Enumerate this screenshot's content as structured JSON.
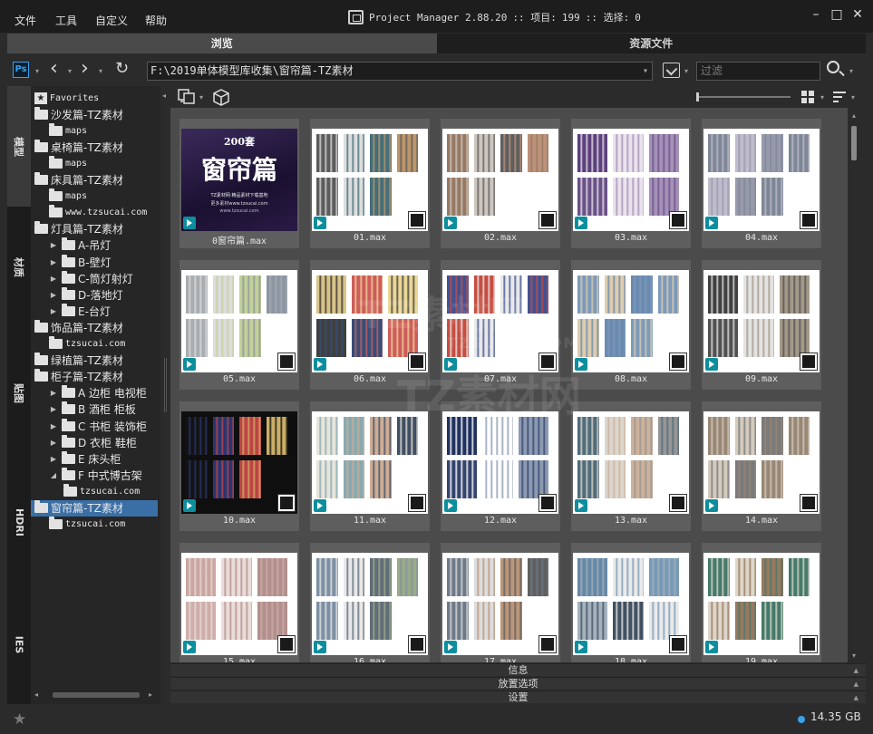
{
  "menu": [
    "文件",
    "工具",
    "自定义",
    "帮助"
  ],
  "title": {
    "app": "Project Manager 2.88.20",
    "items_label": ":: 项目:",
    "items_count": "199",
    "sel_label": ":: 选择:",
    "sel_count": "0"
  },
  "tabs": [
    {
      "label": "浏览",
      "active": true
    },
    {
      "label": "资源文件",
      "active": false
    }
  ],
  "path": {
    "value": "F:\\2019单体模型库收集\\窗帘篇-TZ素材",
    "filter_placeholder": "过滤"
  },
  "side_tabs": [
    "模型",
    "材质",
    "贴图",
    "HDRI",
    "IES"
  ],
  "tree": [
    {
      "label": "Favorites",
      "type": "favorites",
      "level": 0
    },
    {
      "label": "沙发篇-TZ素材",
      "type": "folder",
      "level": 0
    },
    {
      "label": "maps",
      "type": "folder",
      "level": 1
    },
    {
      "label": "桌椅篇-TZ素材",
      "type": "folder",
      "level": 0
    },
    {
      "label": "maps",
      "type": "folder",
      "level": 1
    },
    {
      "label": "床具篇-TZ素材",
      "type": "folder",
      "level": 0
    },
    {
      "label": "maps",
      "type": "folder",
      "level": 1
    },
    {
      "label": "www.tzsucai.com",
      "type": "folder",
      "level": 1
    },
    {
      "label": "灯具篇-TZ素材",
      "type": "folder",
      "level": 0
    },
    {
      "label": "A-吊灯",
      "type": "folder",
      "level": 1,
      "collapsed": true
    },
    {
      "label": "B-壁灯",
      "type": "folder",
      "level": 1,
      "collapsed": true
    },
    {
      "label": "C-筒灯射灯",
      "type": "folder",
      "level": 1,
      "collapsed": true
    },
    {
      "label": "D-落地灯",
      "type": "folder",
      "level": 1,
      "collapsed": true
    },
    {
      "label": "E-台灯",
      "type": "folder",
      "level": 1,
      "collapsed": true
    },
    {
      "label": "饰品篇-TZ素材",
      "type": "folder",
      "level": 0
    },
    {
      "label": "tzsucai.com",
      "type": "folder",
      "level": 1
    },
    {
      "label": "绿植篇-TZ素材",
      "type": "folder",
      "level": 0
    },
    {
      "label": "柜子篇-TZ素材",
      "type": "folder",
      "level": 0
    },
    {
      "label": "A 边柜 电视柜",
      "type": "folder",
      "level": 1,
      "collapsed": true
    },
    {
      "label": "B 酒柜 柜板",
      "type": "folder",
      "level": 1,
      "collapsed": true
    },
    {
      "label": "C 书柜 装饰柜",
      "type": "folder",
      "level": 1,
      "collapsed": true
    },
    {
      "label": "D 衣柜 鞋柜",
      "type": "folder",
      "level": 1,
      "collapsed": true
    },
    {
      "label": "E 床头柜",
      "type": "folder",
      "level": 1,
      "collapsed": true
    },
    {
      "label": "F 中式博古架",
      "type": "folder",
      "level": 1,
      "expanded": true
    },
    {
      "label": "tzsucai.com",
      "type": "folder",
      "level": 2
    },
    {
      "label": "窗帘篇-TZ素材",
      "type": "folder",
      "level": 0,
      "selected": true
    },
    {
      "label": "tzsucai.com",
      "type": "folder",
      "level": 1
    }
  ],
  "thumbs": [
    {
      "name": "0窗帘篇.max",
      "poster_count": "200套",
      "poster_title": "窗帘篇",
      "poster_sub": "TZ素材网·精品素材下载基地",
      "poster_sub2": "更多素材www.tzsucai.com",
      "poster_site": "www.tzsucai.com"
    },
    {
      "name": "01.max"
    },
    {
      "name": "02.max"
    },
    {
      "name": "03.max"
    },
    {
      "name": "04.max"
    },
    {
      "name": "05.max"
    },
    {
      "name": "06.max"
    },
    {
      "name": "07.max"
    },
    {
      "name": "08.max"
    },
    {
      "name": "09.max"
    },
    {
      "name": "10.max"
    },
    {
      "name": "11.max"
    },
    {
      "name": "12.max"
    },
    {
      "name": "13.max"
    },
    {
      "name": "14.max"
    },
    {
      "name": "15.max"
    },
    {
      "name": "16.max"
    },
    {
      "name": "17.max"
    },
    {
      "name": "18.max"
    },
    {
      "name": "19.max"
    }
  ],
  "watermark": {
    "text": "TZ素材网",
    "url": "TZSUCAI.COM"
  },
  "panels": [
    "信息",
    "放置选项",
    "设置"
  ],
  "status": {
    "disk": "14.35 GB"
  },
  "colors": {
    "accent": "#3aa0e8",
    "selected": "#3a6fa6",
    "max_icon": "#0c8e9e"
  }
}
